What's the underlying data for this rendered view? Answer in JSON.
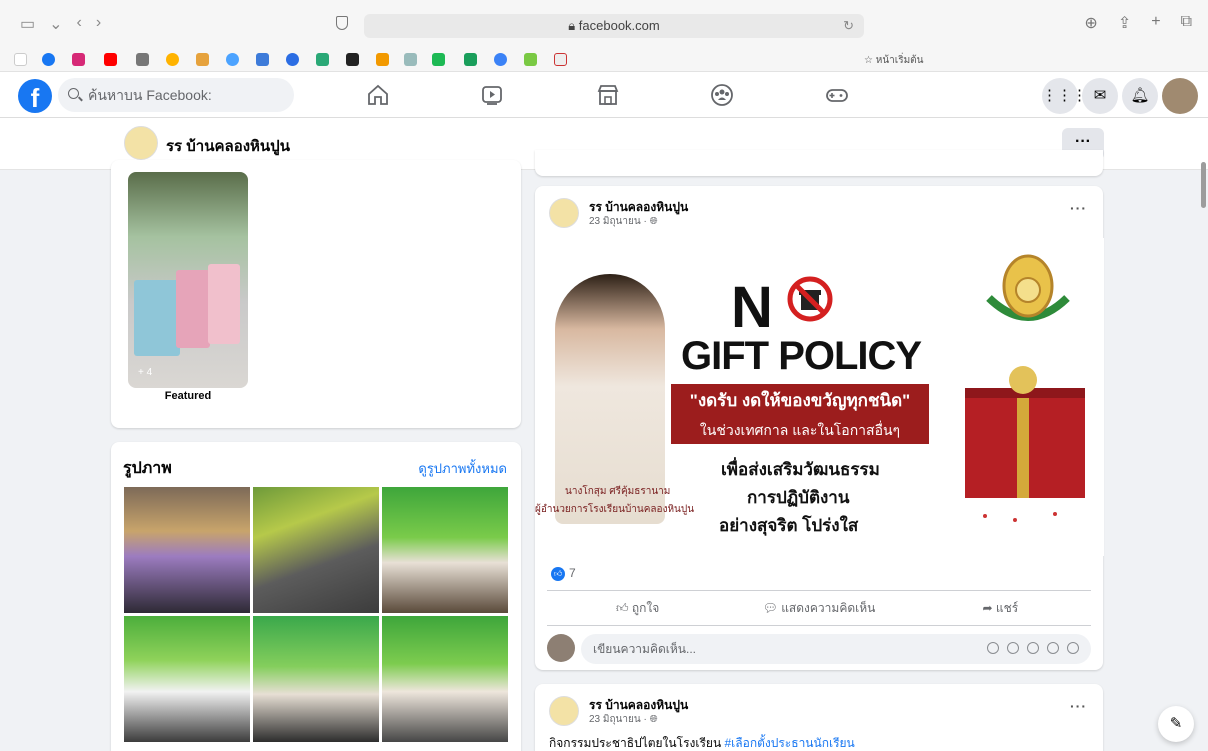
{
  "browser": {
    "url": "facebook.com",
    "home_bookmark": "☆ หน้าเริ่มต้น"
  },
  "fb_nav": {
    "logo": "f",
    "search_placeholder": "ค้นหาบน Facebook:"
  },
  "page": {
    "name": "รร บ้านคลองหินปูน",
    "more_label": "···"
  },
  "featured": {
    "count_label": "+ 4",
    "label": "Featured"
  },
  "photos": {
    "title": "รูปภาพ",
    "see_all": "ดูรูปภาพทั้งหมด"
  },
  "post1": {
    "author": "รร บ้านคลองหินปูน",
    "time": "23 มิถุนายน · ",
    "more": "···",
    "poster": {
      "n_letter": "N",
      "gift_policy": "GIFT POLICY",
      "band_main": "\"งดรับ งดให้ของขวัญทุกชนิด\"",
      "band_sub": "ในช่วงเทศกาล และในโอกาสอื่นๆ",
      "line1": "เพื่อส่งเสริมวัฒนธรรม",
      "line2": "การปฏิบัติงาน",
      "line3": "อย่างสุจริต โปร่งใส",
      "caption_name": "นางโกสุม ศรีคุ้มธรานาม",
      "caption_title": "ผู้อำนวยการโรงเรียนบ้านคลองหินปูน"
    },
    "reaction_count": "7",
    "actions": {
      "like": "ถูกใจ",
      "comment": "แสดงความคิดเห็น",
      "share": "แชร์"
    },
    "comment_placeholder": "เขียนความคิดเห็น..."
  },
  "post2": {
    "author": "รร บ้านคลองหินปูน",
    "time": "23 มิถุนายน · ",
    "more": "···",
    "text": "กิจกรรมประชาธิปไตยในโรงเรียน ",
    "hashtag": "#เลือกตั้งประธานนักเรียน"
  },
  "colors": {
    "fb_blue": "#1877f2",
    "poster_red": "#9c1d1d",
    "page_bg": "#f0f2f5"
  }
}
